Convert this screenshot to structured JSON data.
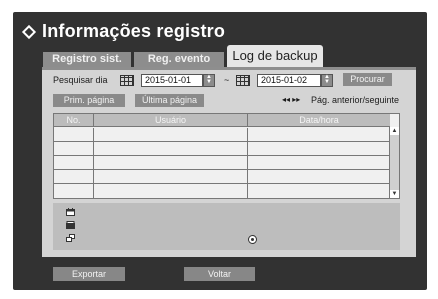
{
  "window": {
    "title": "Informações registro"
  },
  "tabs": [
    {
      "label": "Registro sist.",
      "active": false
    },
    {
      "label": "Reg. evento",
      "active": false
    },
    {
      "label": "Log de backup",
      "active": true
    }
  ],
  "search": {
    "label": "Pesquisar dia",
    "start_date": "2015-01-01",
    "separator": "~",
    "end_date": "2015-01-02",
    "button": "Procurar"
  },
  "pagination": {
    "first_page": "Prim. página",
    "last_page": "Última página",
    "prev_next_glyphs": "◂◂ ▸▸",
    "prev_next_label": "Pág. anterior/seguinte"
  },
  "table": {
    "columns": [
      "No.",
      "Usuário",
      "Data/hora"
    ],
    "rows": [
      [
        "",
        "",
        ""
      ],
      [
        "",
        "",
        ""
      ],
      [
        "",
        "",
        ""
      ],
      [
        "",
        "",
        ""
      ],
      [
        "",
        "",
        ""
      ]
    ]
  },
  "footer": {
    "export": "Exportar",
    "back": "Voltar"
  },
  "colors": {
    "frame": "#323232",
    "panel": "#d4d4d4",
    "button": "#8a8a8a",
    "active_tab": "#e6e6e6"
  }
}
